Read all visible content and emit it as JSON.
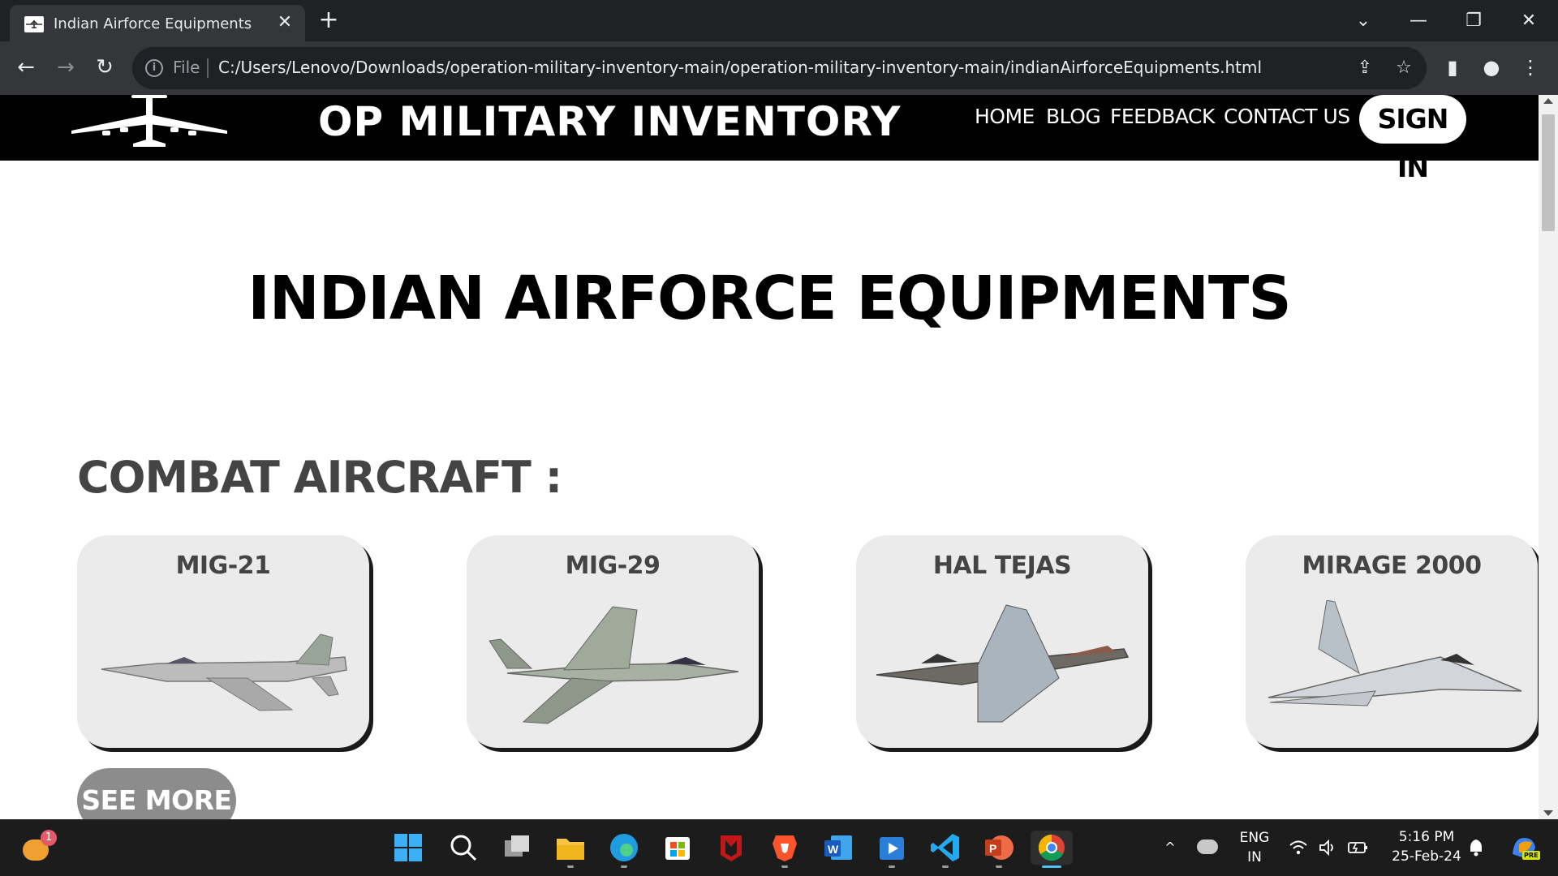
{
  "browser": {
    "tab_title": "Indian Airforce Equipments",
    "tab_close": "✕",
    "new_tab": "+",
    "window_controls": {
      "dropdown": "⌄",
      "minimize": "—",
      "restore": "❐",
      "close": "✕"
    },
    "nav": {
      "back": "←",
      "forward": "→",
      "reload": "↻"
    },
    "address_bar": {
      "scheme_label": "File",
      "url": "C:/Users/Lenovo/Downloads/operation-military-inventory-main/operation-military-inventory-main/indianAirforceEquipments.html"
    },
    "icons": {
      "share": "⇪",
      "bookmark": "☆",
      "side_panel": "▮",
      "profile": "●",
      "menu": "⋮"
    }
  },
  "site": {
    "title": "OP MILITARY INVENTORY",
    "nav": [
      {
        "label": "HOME"
      },
      {
        "label": "BLOG"
      },
      {
        "label": "FEEDBACK"
      },
      {
        "label": "CONTACT US"
      }
    ],
    "signin_label": "SIGN IN"
  },
  "main": {
    "heading": "INDIAN AIRFORCE EQUIPMENTS",
    "section_heading": "COMBAT AIRCRAFT :",
    "cards": [
      {
        "title": "MIG-21"
      },
      {
        "title": "MIG-29"
      },
      {
        "title": "HAL TEJAS"
      },
      {
        "title": "MIRAGE 2000"
      }
    ],
    "see_more_label": "SEE MORE"
  },
  "taskbar": {
    "weather_badge": "1",
    "language": {
      "line1": "ENG",
      "line2": "IN"
    },
    "clock": {
      "time": "5:16 PM",
      "date": "25-Feb-24"
    },
    "tray_up": "^",
    "copilot_badge": "PRE"
  }
}
